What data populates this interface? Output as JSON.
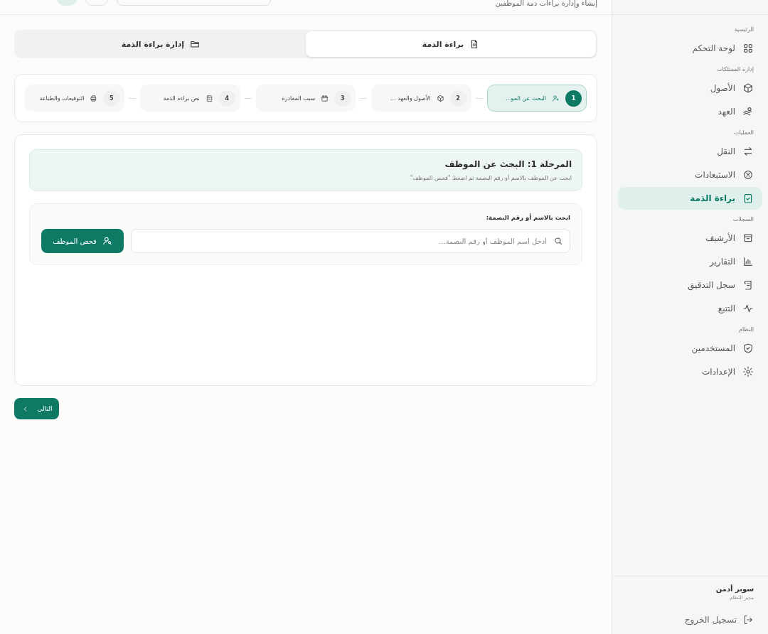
{
  "header": {
    "subtitle": "إنشاء وإدارة براءات ذمة الموظفين"
  },
  "tabs": [
    {
      "label": "براءة الذمة",
      "selected": true
    },
    {
      "label": "إدارة براءة الذمة",
      "selected": false
    }
  ],
  "steps": [
    {
      "number": "1",
      "label": "البحث عن المو...",
      "selected": true
    },
    {
      "number": "2",
      "label": "الأصول والعهد ...",
      "selected": false
    },
    {
      "number": "3",
      "label": "سبب المغادرة",
      "selected": false
    },
    {
      "number": "4",
      "label": "نص براءة الذمة",
      "selected": false
    },
    {
      "number": "5",
      "label": "التوقيعات والطباعة",
      "selected": false
    }
  ],
  "stage": {
    "title": "المرحلة 1: البحث عن الموظف",
    "hint": "ابحث عن الموظف بالاسم أو رقم البصمة ثم اضغط \"فحص الموظف\""
  },
  "search": {
    "label": "ابحث بالاسم أو رقم البصمة:",
    "placeholder": "أدخل اسم الموظف أو رقم البصمة...",
    "button": "فحص الموظف"
  },
  "next_button": "التالي",
  "sidebar": {
    "items": [
      {
        "kind": "section",
        "label": "الرئيسية"
      },
      {
        "kind": "item",
        "label": "لوحة التحكم",
        "selected": false
      },
      {
        "kind": "section",
        "label": "إدارة الممتلكات"
      },
      {
        "kind": "item",
        "label": "الأصول",
        "selected": false
      },
      {
        "kind": "item",
        "label": "العهد",
        "selected": false
      },
      {
        "kind": "section",
        "label": "العمليات"
      },
      {
        "kind": "item",
        "label": "النقل",
        "selected": false
      },
      {
        "kind": "item",
        "label": "الاستبعادات",
        "selected": false
      },
      {
        "kind": "item",
        "label": "براءة الذمة",
        "selected": true
      },
      {
        "kind": "section",
        "label": "السجلات"
      },
      {
        "kind": "item",
        "label": "الأرشيف",
        "selected": false
      },
      {
        "kind": "item",
        "label": "التقارير",
        "selected": false
      },
      {
        "kind": "item",
        "label": "سجل التدقيق",
        "selected": false
      },
      {
        "kind": "item",
        "label": "التتبع",
        "selected": false
      },
      {
        "kind": "section",
        "label": "النظام"
      },
      {
        "kind": "item",
        "label": "المستخدمين",
        "selected": false
      },
      {
        "kind": "item",
        "label": "الإعدادات",
        "selected": false
      }
    ],
    "user": {
      "name": "سوبر أدمن",
      "role": "مدير النظام"
    },
    "logout": "تسجيل الخروج"
  }
}
